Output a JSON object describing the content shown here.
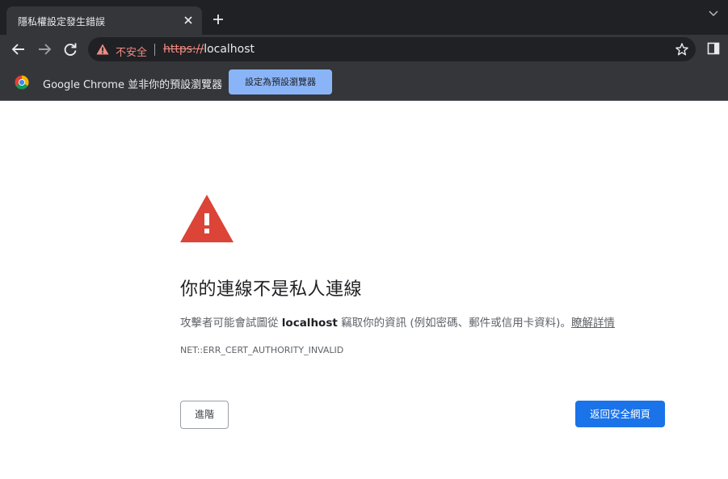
{
  "tab": {
    "title": "隱私權設定發生錯誤"
  },
  "toolbar": {
    "security_label": "不安全",
    "url_scheme": "https://",
    "url_host": "localhost"
  },
  "infobar": {
    "text": "Google Chrome 並非你的預設瀏覽器",
    "button_label": "設定為預設瀏覽器"
  },
  "interstitial": {
    "heading": "你的連線不是私人連線",
    "desc_prefix": "攻擊者可能會試圖從",
    "desc_host": "localhost",
    "desc_suffix": "竊取你的資訊 (例如密碼、郵件或信用卡資料)。",
    "learn_more": "瞭解詳情",
    "error_code": "NET::ERR_CERT_AUTHORITY_INVALID",
    "advanced_label": "進階",
    "back_label": "返回安全網頁"
  },
  "colors": {
    "frame": "#202124",
    "toolbar": "#35363a",
    "warning_red": "#db4437",
    "not_secure_red": "#f28b82",
    "primary_blue": "#1a73e8",
    "infobar_button": "#8ab4f8"
  }
}
